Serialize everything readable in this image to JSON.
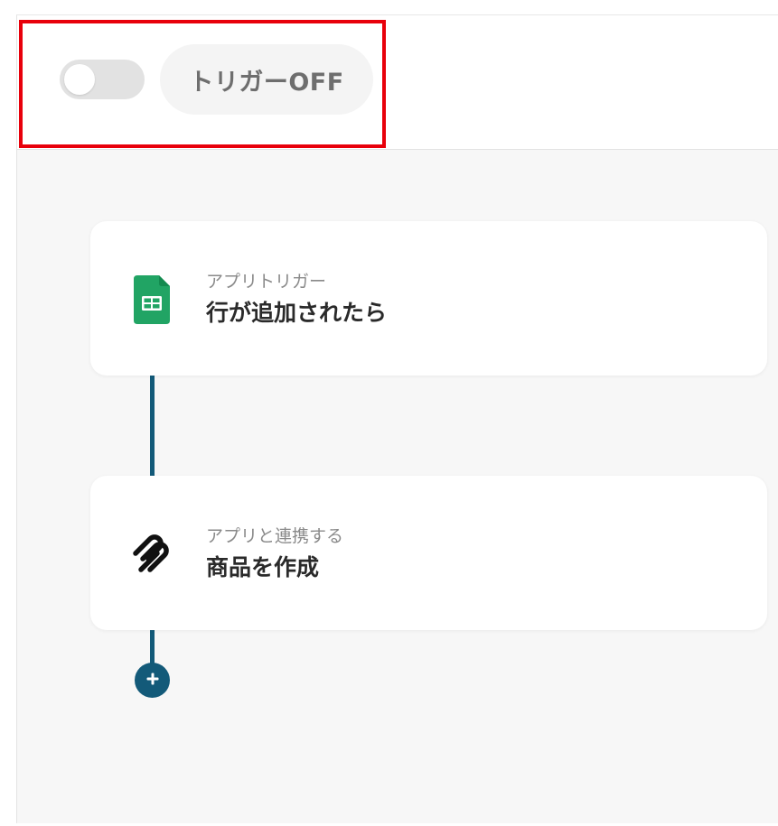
{
  "header": {
    "trigger_status_label": "トリガーOFF"
  },
  "flow": {
    "steps": [
      {
        "subtitle": "アプリトリガー",
        "title": "行が追加されたら",
        "icon": "google-sheets-icon"
      },
      {
        "subtitle": "アプリと連携する",
        "title": "商品を作成",
        "icon": "squarespace-icon"
      }
    ],
    "add_step_icon": "plus-icon"
  },
  "colors": {
    "accent": "#135a79",
    "highlight": "#e8000b",
    "sheets_green": "#21a464",
    "canvas_bg": "#f7f7f7"
  }
}
